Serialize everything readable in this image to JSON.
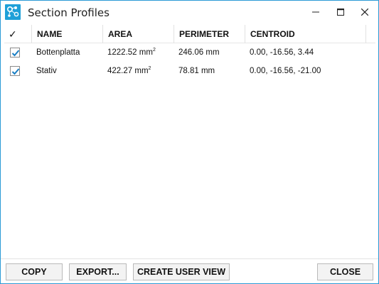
{
  "window": {
    "title": "Section Profiles",
    "accent_color": "#2b9ad6",
    "icon": "app-logo-icon"
  },
  "table": {
    "columns": [
      {
        "key": "check",
        "label": "✓"
      },
      {
        "key": "name",
        "label": "NAME"
      },
      {
        "key": "area",
        "label": "AREA"
      },
      {
        "key": "perimeter",
        "label": "PERIMETER"
      },
      {
        "key": "centroid",
        "label": "CENTROID"
      }
    ],
    "rows": [
      {
        "checked": true,
        "name": "Bottenplatta",
        "area": "1222.52 mm",
        "area_unit_sup": "2",
        "perimeter": "246.06 mm",
        "centroid": "0.00, -16.56, 3.44"
      },
      {
        "checked": true,
        "name": "Stativ",
        "area": "422.27 mm",
        "area_unit_sup": "2",
        "perimeter": "78.81 mm",
        "centroid": "0.00, -16.56, -21.00"
      }
    ]
  },
  "footer": {
    "copy_label": "COPY",
    "export_label": "EXPORT...",
    "create_user_view_label": "CREATE USER VIEW",
    "close_label": "CLOSE"
  }
}
